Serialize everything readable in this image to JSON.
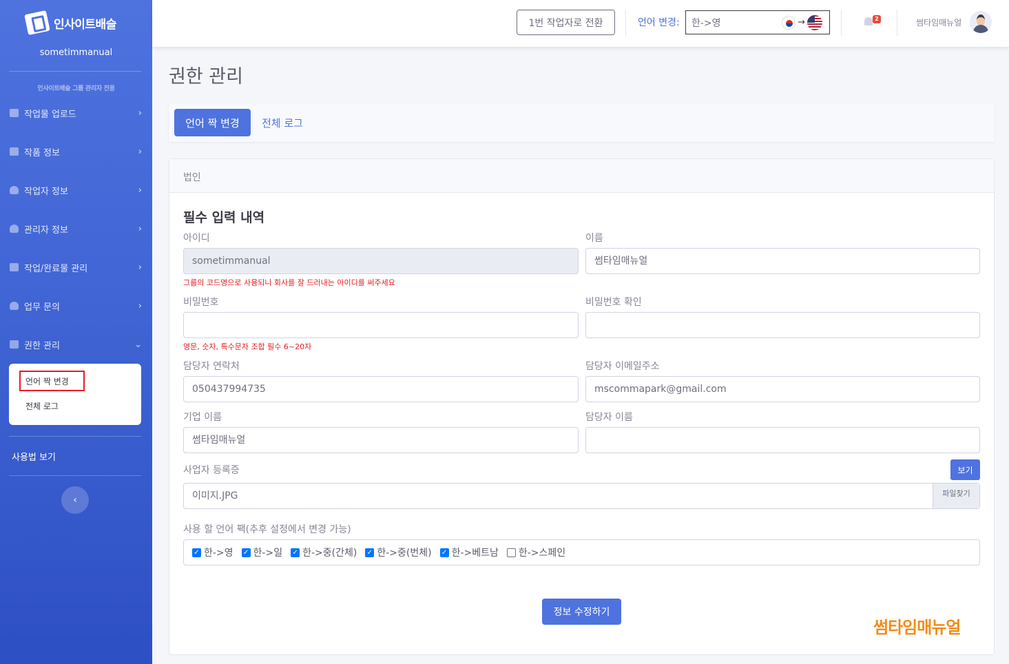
{
  "sidebar": {
    "brand": "인사이트배슬",
    "username": "sometimmanual",
    "heading": "인사이트배슬 그룹 관리자 전용",
    "items": [
      {
        "label": "작업물 업로드",
        "chev": "›"
      },
      {
        "label": "작품 정보",
        "chev": "›"
      },
      {
        "label": "작업자 정보",
        "chev": "›"
      },
      {
        "label": "관리자 정보",
        "chev": "›"
      },
      {
        "label": "작업/완료물 관리",
        "chev": "›"
      },
      {
        "label": "업무 문의",
        "chev": "›"
      },
      {
        "label": "권한 관리",
        "chev": "⌄"
      }
    ],
    "submenu": [
      "언어 짝 변경",
      "전체 로그"
    ],
    "usage": "사용법 보기",
    "toggle": "‹"
  },
  "topbar": {
    "switch_button": "1번 작업자로 전환",
    "lang_label": "언어 변경:",
    "lang_value": "한->영",
    "arrow": "→",
    "notification_count": "2",
    "username": "썸타임매뉴얼"
  },
  "page": {
    "title": "권한 관리",
    "tabs": [
      "언어 짝 변경",
      "전체 로그"
    ]
  },
  "form": {
    "header": "법인",
    "section_title": "필수 입력 내역",
    "id_label": "아이디",
    "id_value": "sometimmanual",
    "id_hint": "그룹의 코드명으로 사용되니 회사를 잘 드러내는 아이디를 써주세요",
    "name_label": "이름",
    "name_value": "썸타임매뉴얼",
    "pw_label": "비밀번호",
    "pw_value": "",
    "pw_hint": "영문, 숫자, 특수문자 조합 필수 6~20자",
    "pw_confirm_label": "비밀번호 확인",
    "pw_confirm_value": "",
    "phone_label": "담당자 연락처",
    "phone_value": "050437994735",
    "email_label": "담당자 이메일주소",
    "email_value": "mscommapark@gmail.com",
    "company_label": "기업 이름",
    "company_value": "썸타임매뉴얼",
    "manager_label": "담당자 이름",
    "manager_value": "",
    "biz_label": "사업자 등록증",
    "view_button": "보기",
    "biz_file": "이미지.JPG",
    "browse_button": "파일찾기",
    "lang_pack_label": "사용 할 언어 팩(추후 설정에서 변경 가능)",
    "lang_packs": [
      {
        "label": "한->영",
        "checked": true
      },
      {
        "label": "한->일",
        "checked": true
      },
      {
        "label": "한->중(간체)",
        "checked": true
      },
      {
        "label": "한->중(번체)",
        "checked": true
      },
      {
        "label": "한->베트남",
        "checked": true
      },
      {
        "label": "한->스페인",
        "checked": false
      }
    ],
    "submit": "정보 수정하기"
  },
  "watermark": "썸타임매뉴얼",
  "colors": {
    "primary": "#4e73df",
    "danger": "#e51c23",
    "watermark": "#f28c17"
  }
}
